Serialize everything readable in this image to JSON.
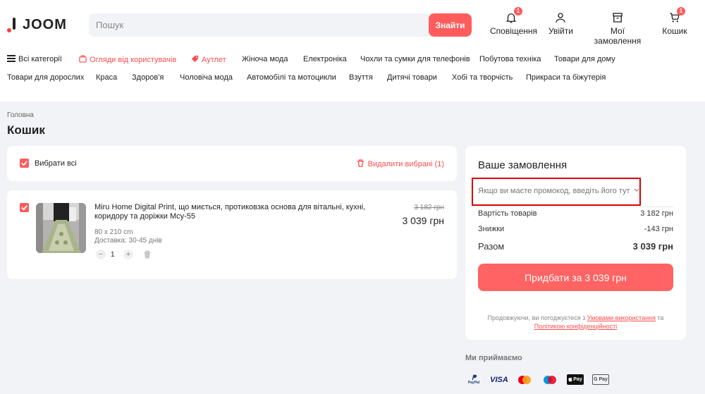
{
  "header": {
    "logo_text": "JOOM",
    "search_placeholder": "Пошук",
    "search_button": "Знайти",
    "notifications_label": "Сповіщення",
    "notifications_badge": "1",
    "login_label": "Увійти",
    "orders_label": "Мої замовлення",
    "cart_label": "Кошик",
    "cart_badge": "1"
  },
  "categories": {
    "row1": [
      "Всі категорії",
      "Огляди від користувачів",
      "Аутлет",
      "Жіноча мода",
      "Електроніка",
      "Чохли та сумки для телефонів",
      "Побутова техніка",
      "Товари для дому"
    ],
    "row2": [
      "Товари для дорослих",
      "Краса",
      "Здоров'я",
      "Чоловіча мода",
      "Автомобілі та мотоцикли",
      "Взуття",
      "Дитячі товари",
      "Хобі та творчість",
      "Прикраси та біжутерія"
    ]
  },
  "breadcrumb": "Головна",
  "page_title": "Кошик",
  "cart": {
    "select_all": "Вибрати всі",
    "delete_selected": "Видалити вибрані (1)",
    "item": {
      "title": "Miru Home Digital Print, що миється, протиковзка основа для вітальні, кухні, коридору та доріжки Mcy-55",
      "size": "80 x 210 cm",
      "delivery": "Доставка: 30-45 днів",
      "quantity": "1",
      "old_price": "3 182 грн",
      "price": "3 039 грн"
    }
  },
  "order": {
    "title": "Ваше замовлення",
    "promo": "Якщо ви маєте промокод, введіть його тут",
    "goods_label": "Вартість товарів",
    "goods_value": "3 182 грн",
    "discount_label": "Знижки",
    "discount_value": "-143 грн",
    "total_label": "Разом",
    "total_value": "3 039 грн",
    "buy_button": "Придбати за 3 039 грн",
    "legal_prefix": "Продовжуючи, ви погоджуєтеся з",
    "legal_terms": "Умовами використання",
    "legal_and": "та",
    "legal_privacy": "Політикою конфіденційності"
  },
  "payments": {
    "title": "Ми приймаємо",
    "paypal": "PayPal",
    "visa": "VISA",
    "applepay": "Pay",
    "gpay": "G Pay"
  },
  "colors": {
    "accent": "#ff5c5c",
    "highlight_box": "#d80000"
  }
}
